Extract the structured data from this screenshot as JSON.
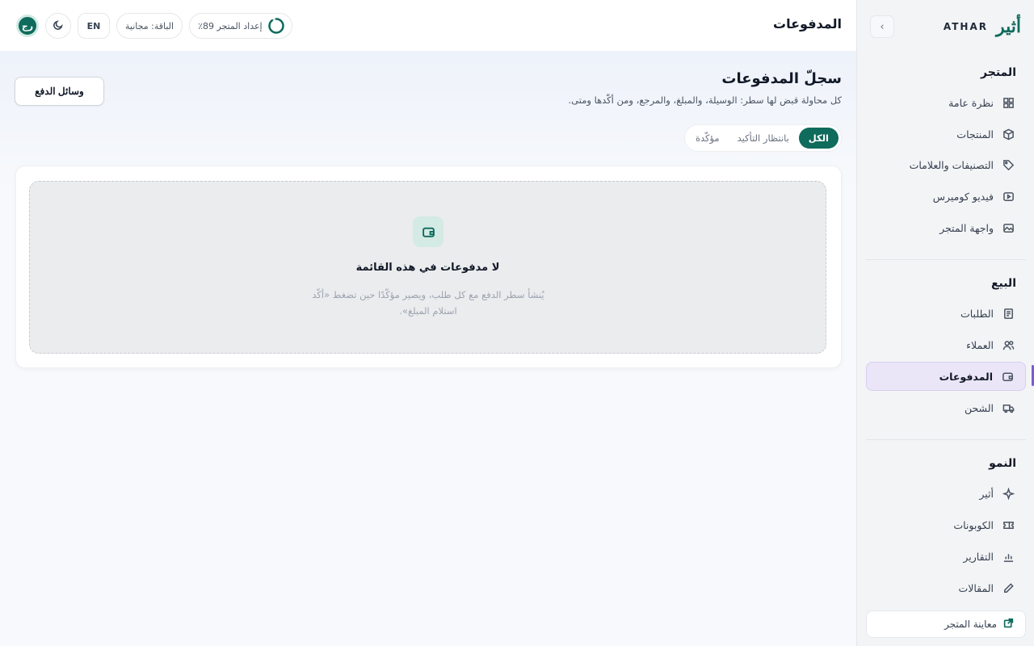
{
  "brand": {
    "logo_text": "أثير",
    "name": "ATHAR"
  },
  "sidebar": {
    "sections": [
      {
        "title": "المتجر",
        "items": [
          {
            "label": "نظرة عامة",
            "icon": "grid-icon"
          },
          {
            "label": "المنتجات",
            "icon": "box-icon"
          },
          {
            "label": "التصنيفات والعلامات",
            "icon": "tag-icon"
          },
          {
            "label": "فيديو كوميرس",
            "icon": "video-icon"
          },
          {
            "label": "واجهة المتجر",
            "icon": "image-icon"
          }
        ]
      },
      {
        "title": "البيع",
        "items": [
          {
            "label": "الطلبات",
            "icon": "receipt-icon"
          },
          {
            "label": "العملاء",
            "icon": "users-icon"
          },
          {
            "label": "المدفوعات",
            "icon": "wallet-icon",
            "active": true
          },
          {
            "label": "الشحن",
            "icon": "truck-icon"
          }
        ]
      },
      {
        "title": "النمو",
        "items": [
          {
            "label": "أثير",
            "icon": "sparkle-icon"
          },
          {
            "label": "الكوبونات",
            "icon": "ticket-icon"
          },
          {
            "label": "التقارير",
            "icon": "chart-icon"
          },
          {
            "label": "المقالات",
            "icon": "pen-icon"
          }
        ]
      }
    ],
    "storefront_link": "معاينة المتجر"
  },
  "topbar": {
    "title": "المدفوعات",
    "avatar_initials": "رج",
    "lang": "EN",
    "plan": "الباقة: مجانية",
    "setup_label": "إعداد المتجر 89٪",
    "setup_progress": 0.89,
    "accent": "#0f6b5c"
  },
  "main": {
    "title": "سجلّ المدفوعات",
    "subtitle": "كل محاولة قبض لها سطر: الوسيلة، والمبلغ، والمرجع، ومن أكّدها ومتى.",
    "methods_button": "وسائل الدفع",
    "filters": [
      "الكل",
      "بانتظار التأكيد",
      "مؤكّدة"
    ],
    "empty": {
      "title": "لا مدفوعات في هذه القائمة",
      "description": "يُنشأ سطر الدفع مع كل طلب، ويصير مؤكّدًا حين تضغط «أكّد استلام المبلغ»."
    }
  }
}
